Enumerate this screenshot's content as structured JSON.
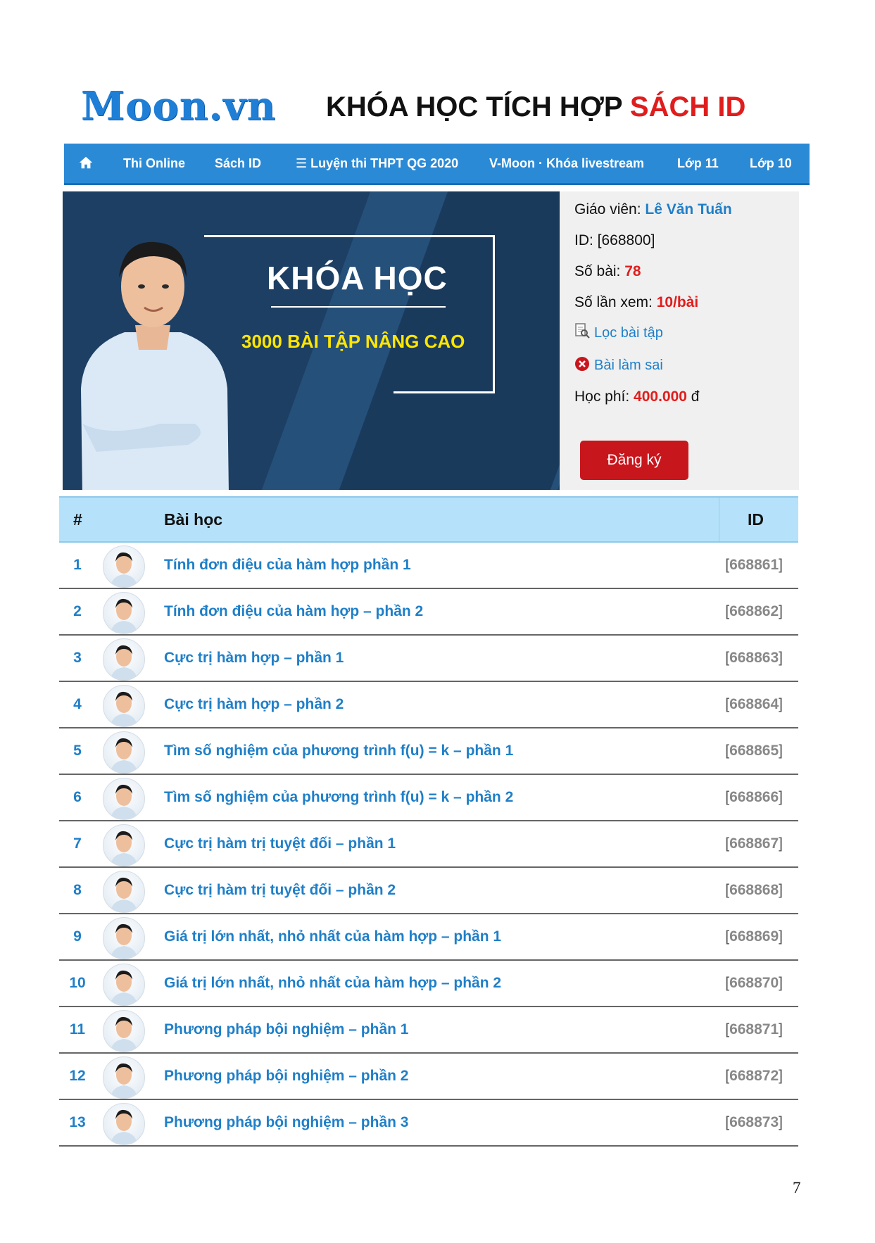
{
  "header": {
    "logo": "Moon.vn",
    "title_main": "KHÓA HỌC TÍCH HỢP ",
    "title_highlight": "SÁCH ID"
  },
  "nav": {
    "home_icon": "home-icon",
    "items": [
      "Thi Online",
      "Sách ID",
      "☰ Luyện thi THPT QG 2020",
      "V-Moon · Khóa livestream",
      "Lớp 11",
      "Lớp 10"
    ]
  },
  "banner": {
    "title": "KHÓA HỌC",
    "subtitle": "3000 BÀI TẬP NÂNG CAO"
  },
  "info": {
    "teacher_label": "Giáo viên: ",
    "teacher_name": "Lê Văn Tuấn",
    "id_text": "ID: [668800]",
    "lessons_label": "Số bài: ",
    "lessons_value": "78",
    "views_label": "Số lần xem: ",
    "views_value": "10/bài",
    "filter_link": "Lọc bài tập",
    "wrong_link": "Bài làm sai",
    "fee_label": "Học phí: ",
    "fee_value": "400.000",
    "fee_unit": " đ",
    "register_button": "Đăng ký"
  },
  "table": {
    "headers": [
      "#",
      "Bài học",
      "ID"
    ],
    "rows": [
      {
        "num": "1",
        "title": "Tính đơn điệu của hàm hợp phần 1",
        "id": "668861"
      },
      {
        "num": "2",
        "title": "Tính đơn điệu của hàm hợp – phần 2",
        "id": "668862"
      },
      {
        "num": "3",
        "title": "Cực trị hàm hợp – phần 1",
        "id": "668863"
      },
      {
        "num": "4",
        "title": "Cực trị hàm hợp – phần 2",
        "id": "668864"
      },
      {
        "num": "5",
        "title": "Tìm số nghiệm của phương trình f(u) = k – phần 1",
        "id": "668865"
      },
      {
        "num": "6",
        "title": "Tìm số nghiệm của phương trình f(u) = k – phần 2",
        "id": "668866"
      },
      {
        "num": "7",
        "title": "Cực trị hàm trị tuyệt đối – phần 1",
        "id": "668867"
      },
      {
        "num": "8",
        "title": "Cực trị hàm trị tuyệt đối – phần 2",
        "id": "668868"
      },
      {
        "num": "9",
        "title": "Giá trị lớn nhất, nhỏ nhất của hàm hợp – phần 1",
        "id": "668869"
      },
      {
        "num": "10",
        "title": "Giá trị lớn nhất, nhỏ nhất của hàm hợp – phần 2",
        "id": "668870"
      },
      {
        "num": "11",
        "title": "Phương pháp bội nghiệm – phần 1",
        "id": "668871"
      },
      {
        "num": "12",
        "title": "Phương pháp bội nghiệm – phần 2",
        "id": "668872"
      },
      {
        "num": "13",
        "title": "Phương pháp bội nghiệm – phần 3",
        "id": "668873"
      }
    ]
  },
  "page_number": "7"
}
